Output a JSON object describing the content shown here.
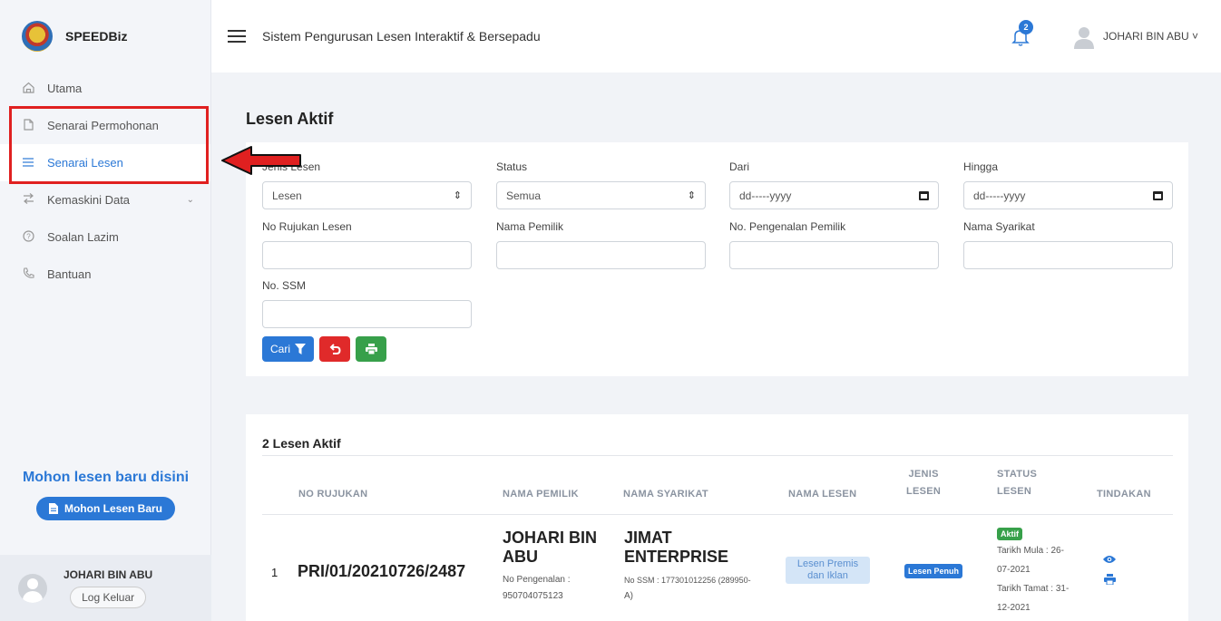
{
  "sidebar": {
    "brand": "SPEEDBiz",
    "items": [
      {
        "label": "Utama",
        "icon": "home-icon"
      },
      {
        "label": "Senarai Permohonan",
        "icon": "file-icon"
      },
      {
        "label": "Senarai Lesen",
        "icon": "list-icon",
        "active": true
      },
      {
        "label": "Kemaskini Data",
        "icon": "swap-icon",
        "has_submenu": true
      },
      {
        "label": "Soalan Lazim",
        "icon": "help-circle-icon"
      },
      {
        "label": "Bantuan",
        "icon": "phone-icon"
      }
    ],
    "promo_title": "Mohon lesen baru disini",
    "promo_button": "Mohon Lesen Baru",
    "user_name": "JOHARI BIN ABU",
    "logout_label": "Log Keluar"
  },
  "topbar": {
    "system_title": "Sistem Pengurusan Lesen Interaktif & Bersepadu",
    "notification_count": "2",
    "user_name": "JOHARI BIN ABU",
    "user_caret": "˅"
  },
  "page": {
    "title": "Lesen Aktif"
  },
  "filters": {
    "jenis_lesen": {
      "label": "Jenis Lesen",
      "value": "Lesen"
    },
    "status": {
      "label": "Status",
      "value": "Semua"
    },
    "dari": {
      "label": "Dari",
      "placeholder": "dd-----yyyy"
    },
    "hingga": {
      "label": "Hingga",
      "placeholder": "dd-----yyyy"
    },
    "no_rujukan": {
      "label": "No Rujukan Lesen",
      "value": ""
    },
    "nama_pemilik": {
      "label": "Nama Pemilik",
      "value": ""
    },
    "no_pengenalan": {
      "label": "No. Pengenalan Pemilik",
      "value": ""
    },
    "nama_syarikat": {
      "label": "Nama Syarikat",
      "value": ""
    },
    "no_ssm": {
      "label": "No. SSM",
      "value": ""
    },
    "search_label": "Cari"
  },
  "table": {
    "title": "2 Lesen Aktif",
    "headers": {
      "no_rujukan": "NO RUJUKAN",
      "nama_pemilik": "NAMA PEMILIK",
      "nama_syarikat": "NAMA SYARIKAT",
      "nama_lesen": "NAMA LESEN",
      "jenis_lesen_1": "JENIS",
      "jenis_lesen_2": "LESEN",
      "status_lesen_1": "STATUS",
      "status_lesen_2": "LESEN",
      "tindakan": "TINDAKAN"
    },
    "rows": [
      {
        "num": "1",
        "ref": "PRI/01/20210726/2487",
        "owner_line1": "JOHARI BIN",
        "owner_line2": "ABU",
        "owner_id_label": "No Pengenalan :",
        "owner_id": "950704075123",
        "company_line1": "JIMAT",
        "company_line2": "ENTERPRISE",
        "ssm_label": "No SSM :",
        "ssm_part1": "177301012256 (289950-",
        "ssm_part2": "A)",
        "license_name": "Lesen Premis dan Iklan",
        "license_type": "Lesen Penuh",
        "status": "Aktif",
        "start_label": "Tarikh Mula :",
        "start_part1": "26-",
        "start_part2": "07-2021",
        "end_label": "Tarikh Tamat :",
        "end_part1": "31-",
        "end_part2": "12-2021"
      }
    ]
  },
  "colors": {
    "primary": "#2b78d6",
    "danger": "#e02a2a",
    "success": "#37a04a",
    "annotation": "#e02020"
  }
}
